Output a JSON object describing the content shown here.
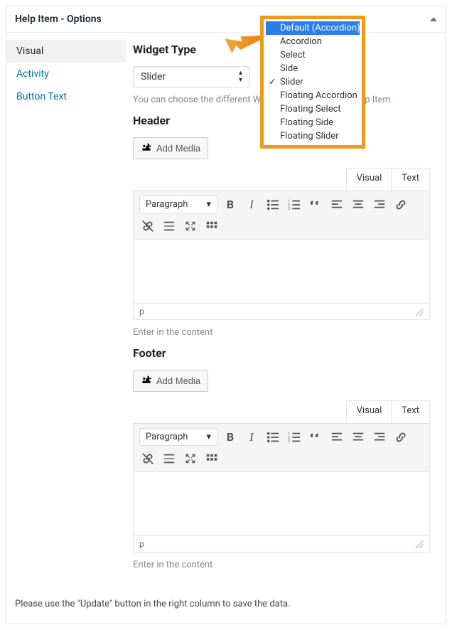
{
  "metabox": {
    "title": "Help Item - Options"
  },
  "tabs": [
    {
      "label": "Visual",
      "active": true
    },
    {
      "label": "Activity",
      "active": false
    },
    {
      "label": "Button Text",
      "active": false
    }
  ],
  "widget_type": {
    "label": "Widget Type",
    "value": "Slider",
    "helper": "You can choose the different Widget Type for current Help Item."
  },
  "dropdown": {
    "highlight": "Default (Accordion)",
    "options": [
      {
        "label": "Default (Accordion)",
        "highlight": true,
        "checked": false
      },
      {
        "label": "Accordion",
        "highlight": false,
        "checked": false
      },
      {
        "label": "Select",
        "highlight": false,
        "checked": false
      },
      {
        "label": "Side",
        "highlight": false,
        "checked": false
      },
      {
        "label": "Slider",
        "highlight": false,
        "checked": true
      },
      {
        "label": "Floating Accordion",
        "highlight": false,
        "checked": false
      },
      {
        "label": "Floating Select",
        "highlight": false,
        "checked": false
      },
      {
        "label": "Floating Side",
        "highlight": false,
        "checked": false
      },
      {
        "label": "Floating Slider",
        "highlight": false,
        "checked": false
      }
    ]
  },
  "editors": {
    "header": {
      "label": "Header",
      "add_media": "Add Media",
      "tabs": {
        "visual": "Visual",
        "text": "Text"
      },
      "format": "Paragraph",
      "status": "p",
      "desc": "Enter in the content"
    },
    "footer": {
      "label": "Footer",
      "add_media": "Add Media",
      "tabs": {
        "visual": "Visual",
        "text": "Text"
      },
      "format": "Paragraph",
      "status": "p",
      "desc": "Enter in the content"
    }
  },
  "footer_note": "Please use the \"Update\" button in the right column to save the data.",
  "icons": {
    "bold": "B",
    "italic": "I"
  }
}
